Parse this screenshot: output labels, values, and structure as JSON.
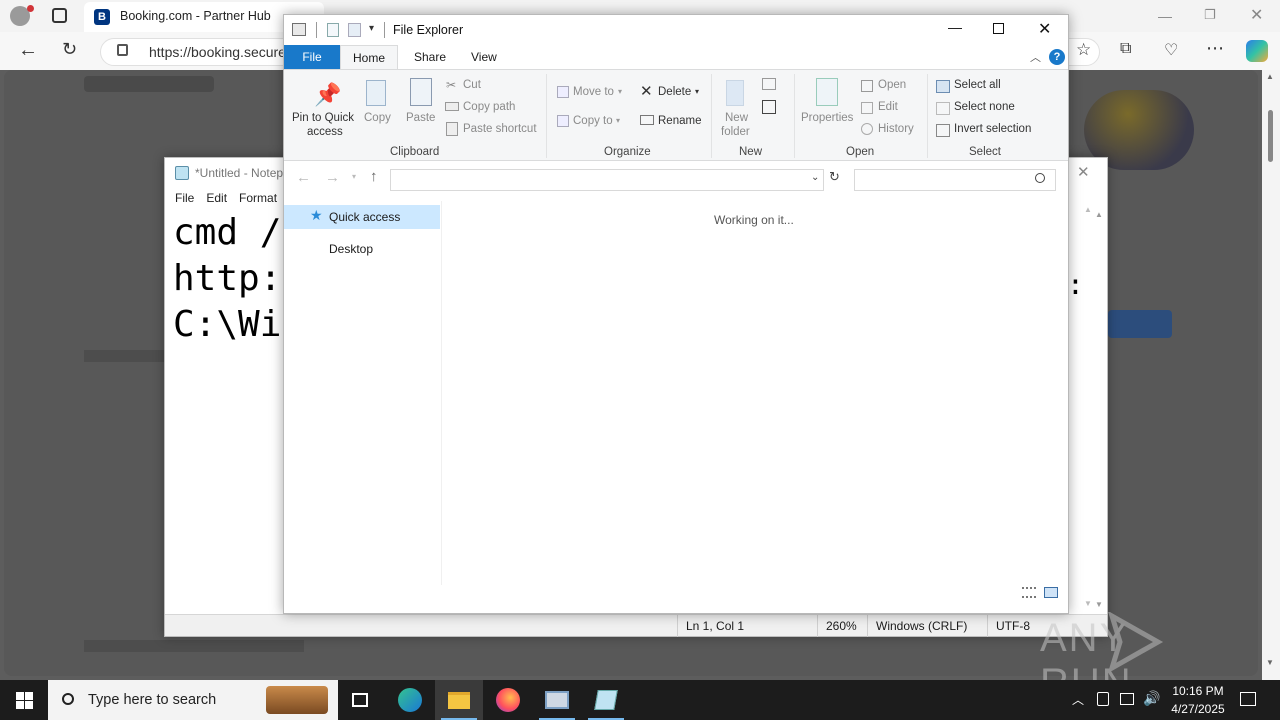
{
  "edge": {
    "tab_title": "Booking.com - Partner Hub",
    "favicon_letter": "B",
    "address_url": "https://booking.secure"
  },
  "notepad": {
    "title": "*Untitled - Notep",
    "menu": [
      "File",
      "Edit",
      "Format"
    ],
    "lines": [
      "cmd /",
      "http:",
      "C:\\Wi"
    ],
    "status": {
      "position": "Ln 1, Col 1",
      "zoom": "260%",
      "line_ending": "Windows (CRLF)",
      "encoding": "UTF-8"
    }
  },
  "explorer": {
    "title": "File Explorer",
    "tabs": [
      "File",
      "Home",
      "Share",
      "View"
    ],
    "clipboard": {
      "pin_label_1": "Pin to Quick",
      "pin_label_2": "access",
      "copy": "Copy",
      "paste": "Paste",
      "cut": "Cut",
      "copy_path": "Copy path",
      "paste_shortcut": "Paste shortcut",
      "group": "Clipboard"
    },
    "organize": {
      "move_to": "Move to",
      "copy_to": "Copy to",
      "delete": "Delete",
      "rename": "Rename",
      "group": "Organize"
    },
    "new": {
      "new_folder_1": "New",
      "new_folder_2": "folder",
      "group": "New"
    },
    "open": {
      "properties": "Properties",
      "open": "Open",
      "edit": "Edit",
      "history": "History",
      "group": "Open"
    },
    "select": {
      "select_all": "Select all",
      "select_none": "Select none",
      "invert": "Invert selection",
      "group": "Select"
    },
    "nav": {
      "quick_access": "Quick access",
      "desktop": "Desktop"
    },
    "content_status": "Working on it..."
  },
  "taskbar": {
    "search_placeholder": "Type here to search",
    "time": "10:16 PM",
    "date": "4/27/2025"
  },
  "watermark": "ANY RUN"
}
